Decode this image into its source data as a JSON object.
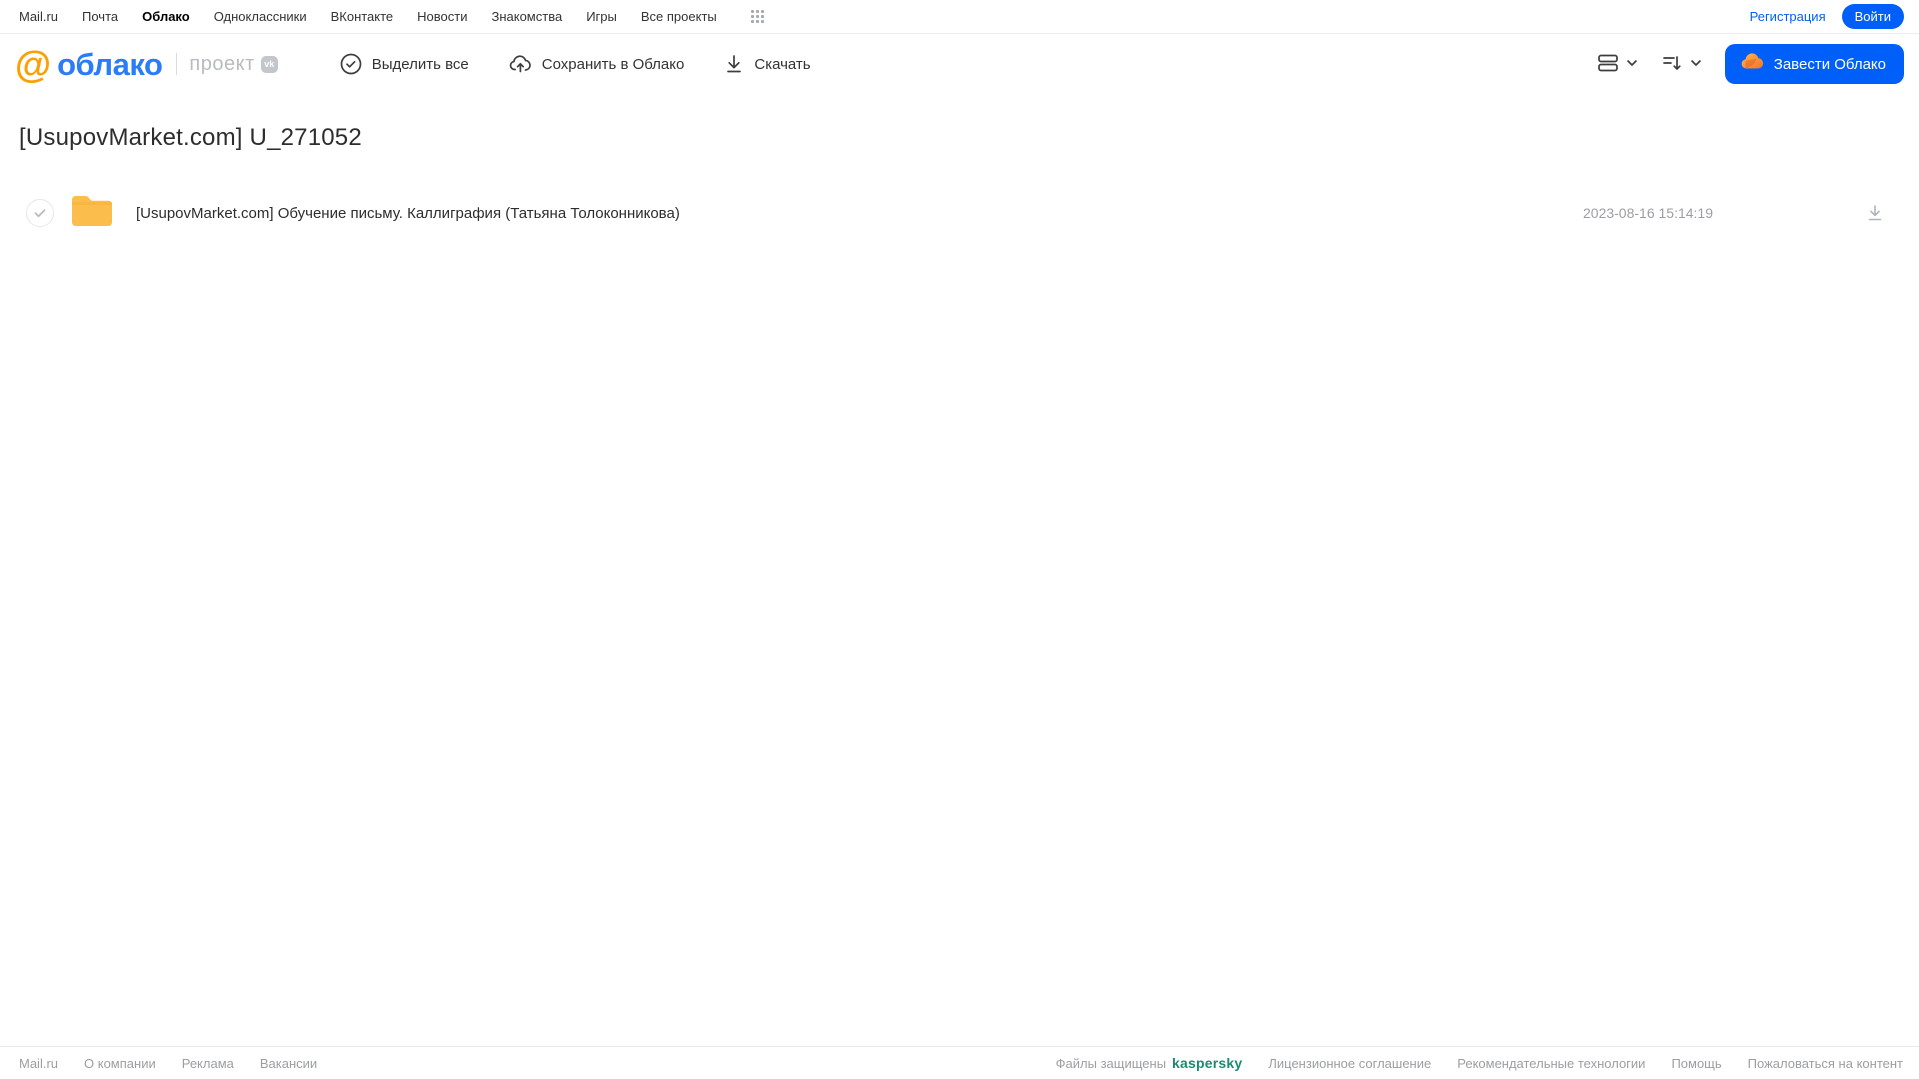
{
  "portal_nav": {
    "links": [
      {
        "label": "Mail.ru"
      },
      {
        "label": "Почта"
      },
      {
        "label": "Облако",
        "active": true
      },
      {
        "label": "Одноклассники"
      },
      {
        "label": "ВКонтакте"
      },
      {
        "label": "Новости"
      },
      {
        "label": "Знакомства"
      },
      {
        "label": "Игры"
      },
      {
        "label": "Все проекты"
      }
    ],
    "registration_label": "Регистрация",
    "login_label": "Войти"
  },
  "header": {
    "logo_at": "@",
    "logo_text": "облако",
    "project_label": "проект",
    "vk_badge": "vk",
    "toolbar": {
      "select_all_label": "Выделить все",
      "save_to_cloud_label": "Сохранить в Облако",
      "download_label": "Скачать"
    },
    "get_cloud_label": "Завести Облако"
  },
  "main": {
    "title": "[UsupovMarket.com] U_271052",
    "files": [
      {
        "type": "folder",
        "name": "[UsupovMarket.com] Обучение письму. Каллиграфия (Татьяна Толоконникова)",
        "date": "2023-08-16 15:14:19"
      }
    ]
  },
  "footer": {
    "left_links": [
      {
        "label": "Mail.ru"
      },
      {
        "label": "О компании"
      },
      {
        "label": "Реклама"
      },
      {
        "label": "Вакансии"
      }
    ],
    "protected_text": "Файлы защищены",
    "kaspersky_label": "kaspersky",
    "right_links": [
      {
        "label": "Лицензионное соглашение"
      },
      {
        "label": "Рекомендательные технологии"
      },
      {
        "label": "Помощь"
      },
      {
        "label": "Пожаловаться на контент"
      }
    ]
  },
  "colors": {
    "accent_blue": "#005ff9",
    "logo_orange": "#ff9e00",
    "logo_blue": "#2b7cf7",
    "folder_yellow": "#fbbd4c",
    "kaspersky_green": "#1d8a70",
    "muted_gray": "#9c9ea3"
  }
}
